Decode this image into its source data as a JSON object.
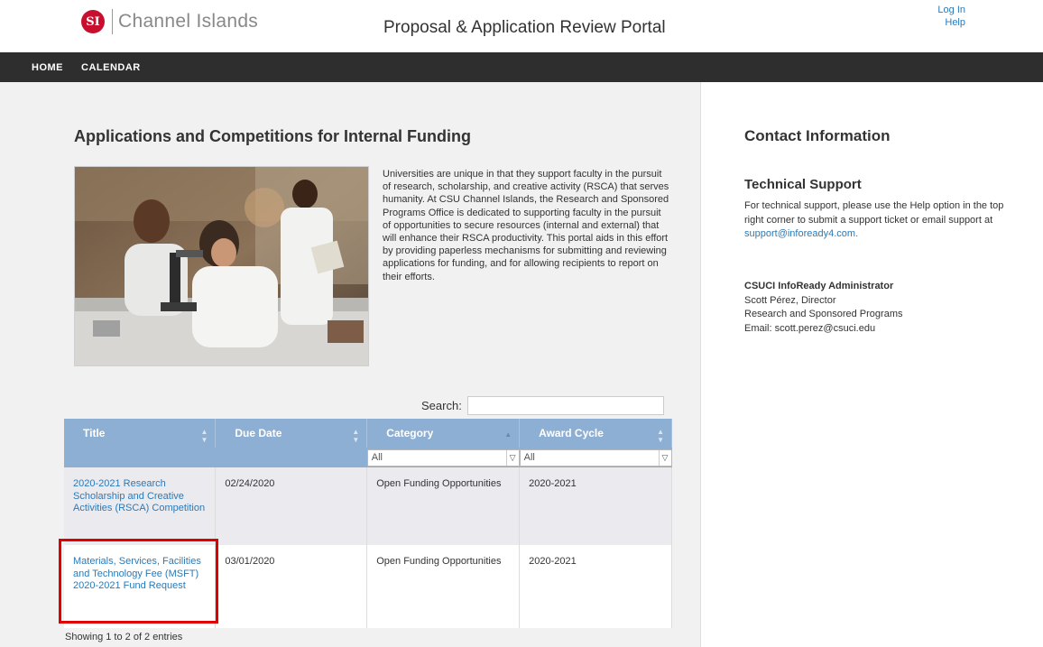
{
  "header": {
    "logo_seal": "SI",
    "logo_text": "Channel Islands",
    "portal_title": "Proposal & Application Review Portal",
    "login_label": "Log In",
    "help_label": "Help"
  },
  "nav": {
    "home_label": "HOME",
    "calendar_label": "CALENDAR"
  },
  "main": {
    "title": "Applications and Competitions for Internal Funding",
    "intro": "Universities are unique in that they support faculty in the pursuit of research, scholarship, and creative activity (RSCA) that serves humanity. At CSU Channel Islands, the Research and Sponsored Programs Office is dedicated to supporting faculty in the pursuit of opportunities to secure resources (internal and external) that will enhance their RSCA productivity. This portal aids in this effort by providing paperless mechanisms for submitting and reviewing applications for funding, and for allowing recipients to report on their efforts.",
    "search_label": "Search:",
    "table": {
      "headers": [
        "Title",
        "Due Date",
        "Category",
        "Award Cycle"
      ],
      "filters": {
        "category": "All",
        "award_cycle": "All"
      },
      "rows": [
        {
          "title": "2020-2021 Research Scholarship and Creative Activities (RSCA) Competition",
          "due_date": "02/24/2020",
          "category": "Open Funding Opportunities",
          "award_cycle": "2020-2021"
        },
        {
          "title": "Materials, Services, Facilities and Technology Fee (MSFT) 2020-2021 Fund Request",
          "due_date": "03/01/2020",
          "category": "Open Funding Opportunities",
          "award_cycle": "2020-2021"
        }
      ]
    },
    "entries_text": "Showing 1 to 2 of 2 entries"
  },
  "sidebar": {
    "title": "Contact Information",
    "tech_title": "Technical Support",
    "tech_text": "For technical support, please use the Help option in the top right corner to submit a support ticket or email support at",
    "tech_email": "support@infoready4.com.",
    "admin_title": "CSUCI InfoReady Administrator",
    "admin_name": "Scott Pérez, Director",
    "admin_dept": "Research and Sponsored Programs",
    "admin_email": "Email: scott.perez@csuci.edu"
  },
  "colors": {
    "nav_bg": "#2e2e2e",
    "table_header": "#8eafd4",
    "link": "#2a7ab8",
    "highlight": "#e10000",
    "brand_red": "#c8102e"
  }
}
